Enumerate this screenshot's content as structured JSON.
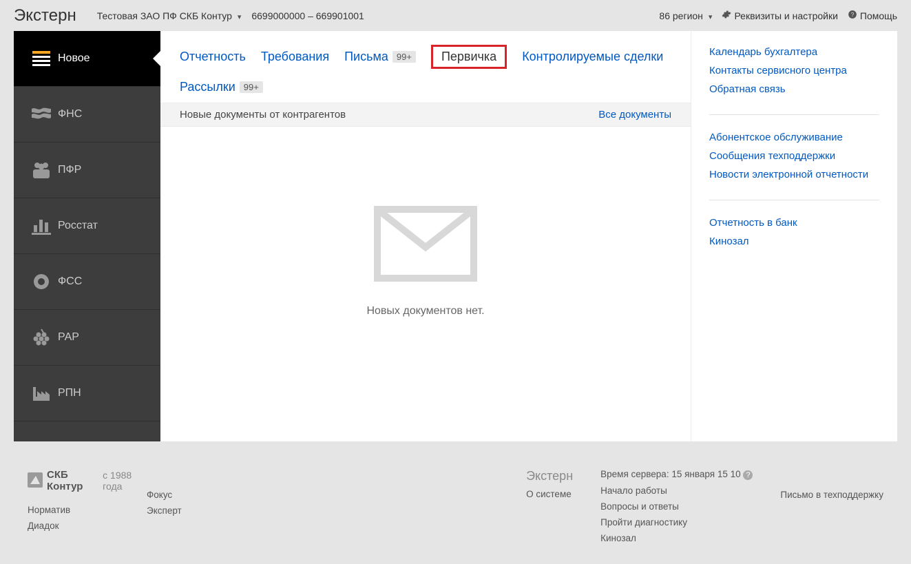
{
  "header": {
    "brand": "Экстерн",
    "org": "Тестовая ЗАО ПФ СКБ Контур",
    "codes": "6699000000 – 669901001",
    "region": "86 регион",
    "settings": "Реквизиты и настройки",
    "help": "Помощь"
  },
  "sidebar": {
    "items": [
      {
        "label": "Новое",
        "icon": "list-icon"
      },
      {
        "label": "ФНС",
        "icon": "flag-icon"
      },
      {
        "label": "ПФР",
        "icon": "people-icon"
      },
      {
        "label": "Росстат",
        "icon": "bar-chart-icon"
      },
      {
        "label": "ФСС",
        "icon": "disc-icon"
      },
      {
        "label": "РАР",
        "icon": "grapes-icon"
      },
      {
        "label": "РПН",
        "icon": "factory-icon"
      }
    ]
  },
  "tabs": {
    "items": [
      {
        "label": "Отчетность"
      },
      {
        "label": "Требования"
      },
      {
        "label": "Письма",
        "badge": "99+"
      },
      {
        "label": "Первичка",
        "highlight": true
      },
      {
        "label": "Контролируемые сделки"
      },
      {
        "label": "Рассылки",
        "badge": "99+"
      }
    ]
  },
  "subhead": {
    "title": "Новые документы от контрагентов",
    "link": "Все документы"
  },
  "empty": {
    "text": "Новых документов нет."
  },
  "sidelinks": {
    "group1": [
      "Календарь бухгалтера",
      "Контакты сервисного центра",
      "Обратная связь"
    ],
    "group2": [
      "Абонентское обслуживание",
      "Сообщения техподдержки",
      "Новости электронной отчетности"
    ],
    "group3": [
      "Отчетность в банк",
      "Кинозал"
    ]
  },
  "footer": {
    "company": "СКБ Контур",
    "since": "с 1988 года",
    "col1": [
      "Норматив",
      "Диадок"
    ],
    "col2": [
      "Фокус",
      "Эксперт"
    ],
    "product": "Экстерн",
    "server_time_label": "Время сервера:",
    "server_time_value": "15 января 15 10",
    "col3": [
      "О системе"
    ],
    "col4": [
      "Начало работы",
      "Вопросы и ответы",
      "Пройти диагностику",
      "Кинозал"
    ],
    "col5": [
      "Письмо в техподдержку"
    ]
  }
}
